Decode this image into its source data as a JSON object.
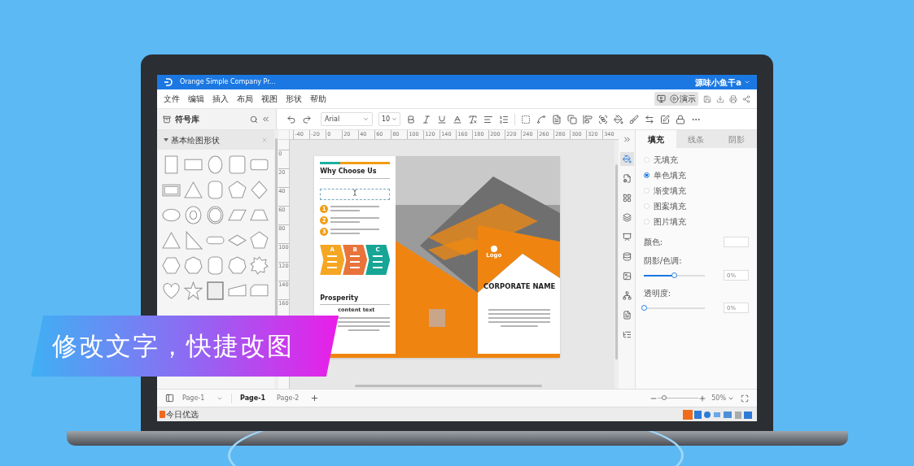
{
  "title_bar": {
    "title": "Orange Simple Company Pr...",
    "user": "源味小鱼干a"
  },
  "menu": [
    "文件",
    "编辑",
    "插入",
    "布局",
    "视图",
    "形状",
    "帮助"
  ],
  "present_button": "演示",
  "symbol_panel": {
    "title": "符号库",
    "section": {
      "title": "基本绘图形状",
      "expanded": true
    }
  },
  "toolbar": {
    "font": "Arial",
    "size": "10"
  },
  "rulers": {
    "horizontal": [
      "-40",
      "-20",
      "0",
      "20",
      "40",
      "60",
      "80",
      "100",
      "120",
      "140",
      "160",
      "180",
      "200",
      "220",
      "240",
      "260",
      "280",
      "300",
      "320",
      "340"
    ],
    "vertical": [
      "0",
      "20",
      "40",
      "60",
      "80",
      "100",
      "120",
      "140",
      "160"
    ]
  },
  "document": {
    "heading": "Why Choose Us",
    "points": [
      {
        "number": "1"
      },
      {
        "number": "2"
      },
      {
        "number": "3"
      }
    ],
    "steps": [
      {
        "letter": "A",
        "color": "#f5a623"
      },
      {
        "letter": "B",
        "color": "#e8743b"
      },
      {
        "letter": "C",
        "color": "#17a596"
      }
    ],
    "section_title": "Prosperity",
    "section_subtitle": "content text",
    "logo": "Logo",
    "company": "CORPORATE NAME"
  },
  "properties": {
    "tabs": [
      {
        "label": "填充",
        "selected": true
      },
      {
        "label": "线条",
        "selected": false
      },
      {
        "label": "阴影",
        "selected": false
      }
    ],
    "fill_options": [
      {
        "label": "无填充",
        "selected": false
      },
      {
        "label": "单色填充",
        "selected": true
      },
      {
        "label": "渐变填充",
        "selected": false
      },
      {
        "label": "图案填充",
        "selected": false
      },
      {
        "label": "图片填充",
        "selected": false
      }
    ],
    "color_label": "颜色:",
    "sliders": [
      {
        "label": "阴影/色调:",
        "level": 0.5,
        "value": "0%"
      },
      {
        "label": "透明度:",
        "level": 0,
        "value": "0%"
      }
    ]
  },
  "pages": {
    "current": "Page-1",
    "tabs": [
      {
        "label": "Page-1",
        "selected": true
      },
      {
        "label": "Page-2",
        "selected": false
      }
    ]
  },
  "zoom": {
    "level": 0.1,
    "value": "50%"
  },
  "taskbar": {
    "app": "今日优选"
  },
  "banner": {
    "text": "修改文字，快捷改图"
  }
}
